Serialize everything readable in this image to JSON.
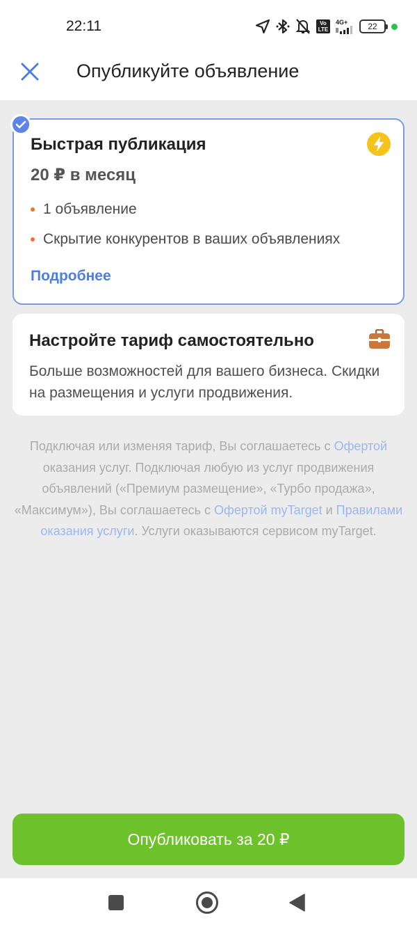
{
  "status": {
    "time": "22:11",
    "volte": "Vo LTE",
    "network": "4G+",
    "battery": "22"
  },
  "header": {
    "title": "Опубликуйте объявление"
  },
  "fast_plan": {
    "title": "Быстрая публикация",
    "price": "20 ₽ в месяц",
    "features": [
      "1 объявление",
      "Скрытие конкурентов в ваших объявлениях"
    ],
    "more_label": "Подробнее",
    "selected": true
  },
  "custom_plan": {
    "title": "Настройте тариф самостоятельно",
    "description": "Больше возможностей для вашего бизнеса. Скидки на размещения и услуги продвижения."
  },
  "legal": {
    "p1": "Подключая или изменяя тариф, Вы соглашаетесь с ",
    "link_offer": "Офертой",
    "p2": " оказания услуг. Подключая любую из услуг продвижения объявлений («Премиум размещение», «Турбо продажа», «Максимум»), Вы соглашаетесь с ",
    "link_mytarget_offer": "Офертой myTarget",
    "p3": " и ",
    "link_rules": "Правилами оказания услуги",
    "p4": ". Услуги оказываются сервисом myTarget."
  },
  "publish_button": {
    "label": "Опубликовать за 20 ₽"
  },
  "colors": {
    "accent_blue": "#5d84e6",
    "publish_green": "#6dc22b",
    "bullet_orange": "#f26f2c",
    "bolt_yellow": "#f6c21c"
  }
}
